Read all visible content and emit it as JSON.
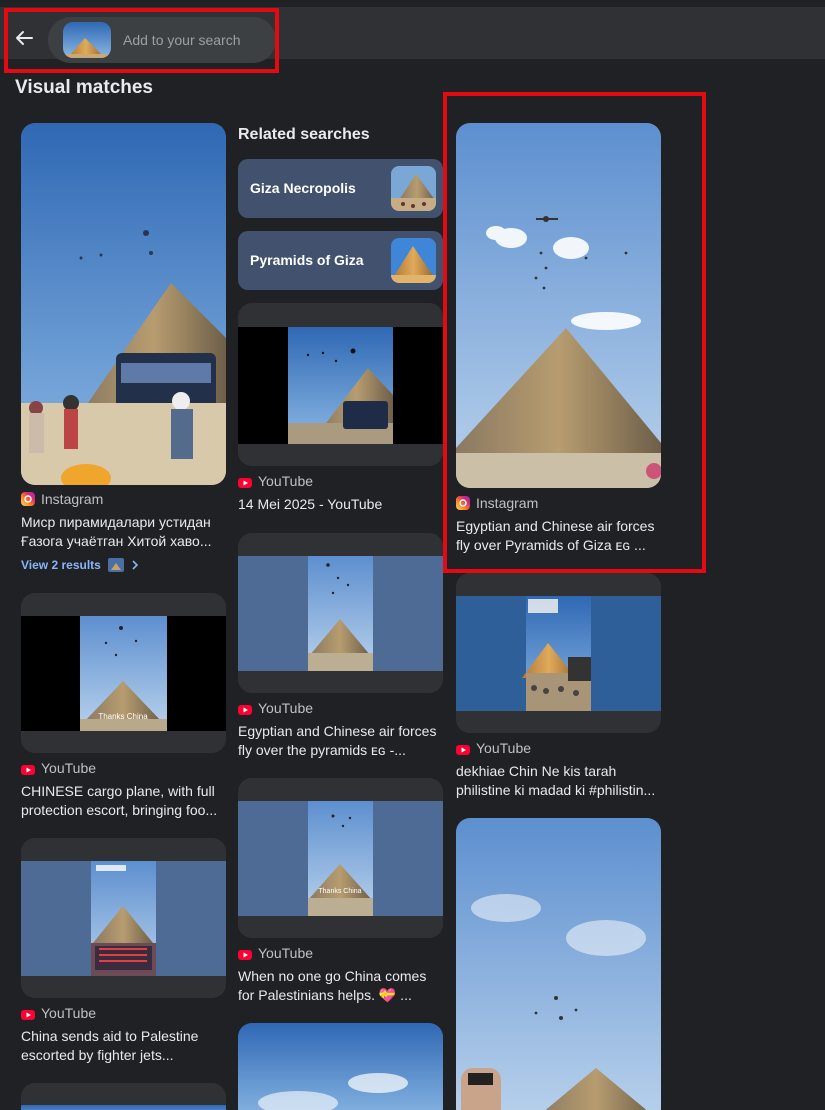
{
  "search_bar": {
    "placeholder": "Add to your search"
  },
  "sections": {
    "visual_matches": "Visual matches",
    "related_searches": "Related searches"
  },
  "related": [
    {
      "label": "Giza Necropolis"
    },
    {
      "label": "Pyramids of Giza"
    }
  ],
  "results": {
    "c1": {
      "source": "Instagram",
      "title_line1": "Миср пирамидалари устидан",
      "title_line2": "Ғазога учаётган Хитой хаво...",
      "more": "View 2 results"
    },
    "c2": {
      "source": "YouTube",
      "title_line1": "CHINESE cargo plane, with full",
      "title_line2": "protection escort, bringing foo...",
      "overlay": "Thanks China"
    },
    "c3": {
      "source": "YouTube",
      "title_line1": "China sends aid to Palestine",
      "title_line2": "escorted by fighter jets..."
    },
    "m1": {
      "source": "YouTube",
      "title_line1": "14 Mei 2025 - YouTube"
    },
    "m2": {
      "source": "YouTube",
      "title_line1": "Egyptian and Chinese air forces",
      "title_line2": "fly over the pyramids ᴇɢ -..."
    },
    "m3": {
      "source": "YouTube",
      "title_line1": "When no one go China comes",
      "title_line2": "for Palestinians helps. 💝 ...",
      "overlay": "Thanks China"
    },
    "r1": {
      "source": "Instagram",
      "title_line1": "Egyptian and Chinese air forces",
      "title_line2": "fly over Pyramids of Giza ᴇɢ ..."
    },
    "r2": {
      "source": "YouTube",
      "title_line1": "dekhiae Chin Ne kis tarah",
      "title_line2": "philistine ki madad ki #philistin..."
    }
  },
  "colors": {
    "youtube": "#ff0033",
    "instagram": "#d62976",
    "highlight": "#e50914",
    "link": "#8ab4f8"
  }
}
